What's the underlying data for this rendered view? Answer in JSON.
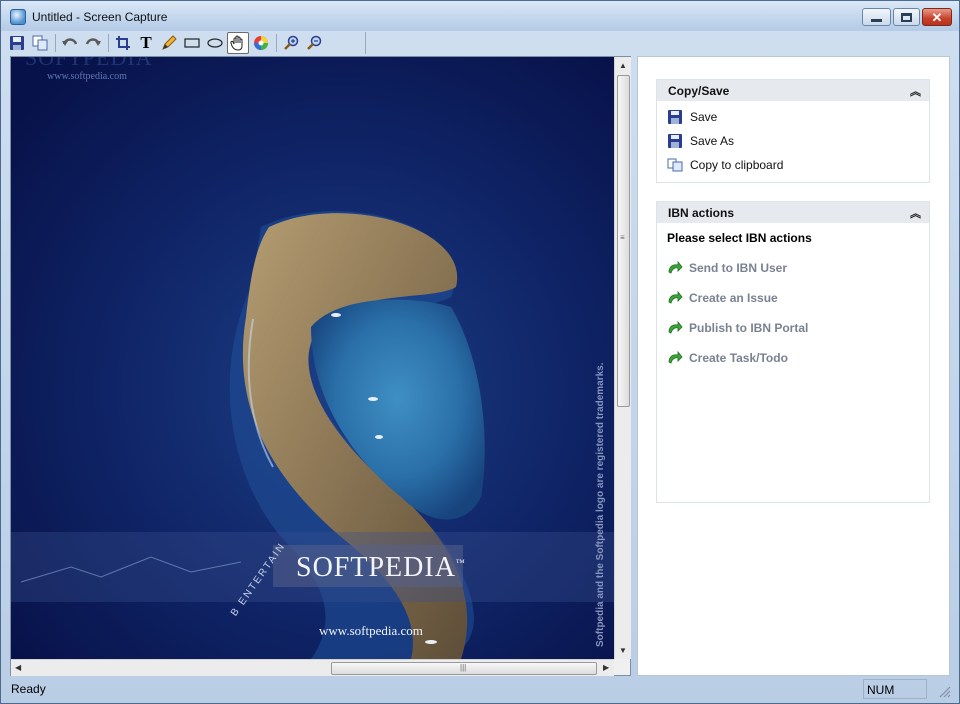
{
  "window": {
    "title": "Untitled - Screen Capture"
  },
  "toolbar": {
    "tools": [
      {
        "name": "save-icon"
      },
      {
        "name": "copy-icon"
      },
      {
        "name": "undo-icon"
      },
      {
        "name": "redo-icon"
      },
      {
        "name": "crop-icon"
      },
      {
        "name": "text-tool-icon"
      },
      {
        "name": "pencil-icon"
      },
      {
        "name": "rectangle-icon"
      },
      {
        "name": "ellipse-icon"
      },
      {
        "name": "hand-icon",
        "active": true
      },
      {
        "name": "color-wheel-icon"
      },
      {
        "name": "zoom-in-icon"
      },
      {
        "name": "zoom-out-icon"
      }
    ]
  },
  "canvas": {
    "watermark_top": "SOFTPEDIA",
    "watermark_url_top": "www.softpedia.com",
    "brand": "SOFTPEDIA",
    "trademark": "™",
    "url": "www.softpedia.com",
    "side_text": "Softpedia and the Softpedia logo are registered trademarks.",
    "arc_text": "B ENTERTAIN",
    "colors": {
      "sea": "#0a1650",
      "lagoon": "#2a6fa8",
      "rock": "#8a7554"
    }
  },
  "panel": {
    "copy_save": {
      "title": "Copy/Save",
      "items": [
        {
          "label": "Save",
          "icon": "floppy-icon"
        },
        {
          "label": "Save As",
          "icon": "floppy-icon"
        },
        {
          "label": "Copy to clipboard",
          "icon": "clipboard-icon"
        }
      ]
    },
    "ibn": {
      "title": "IBN actions",
      "subtitle": "Please select IBN actions",
      "items": [
        {
          "label": "Send to IBN User"
        },
        {
          "label": "Create an Issue"
        },
        {
          "label": "Publish to IBN Portal"
        },
        {
          "label": "Create Task/Todo"
        }
      ],
      "disabled_color": "#7a8190"
    }
  },
  "status": {
    "text": "Ready",
    "num": "NUM"
  }
}
